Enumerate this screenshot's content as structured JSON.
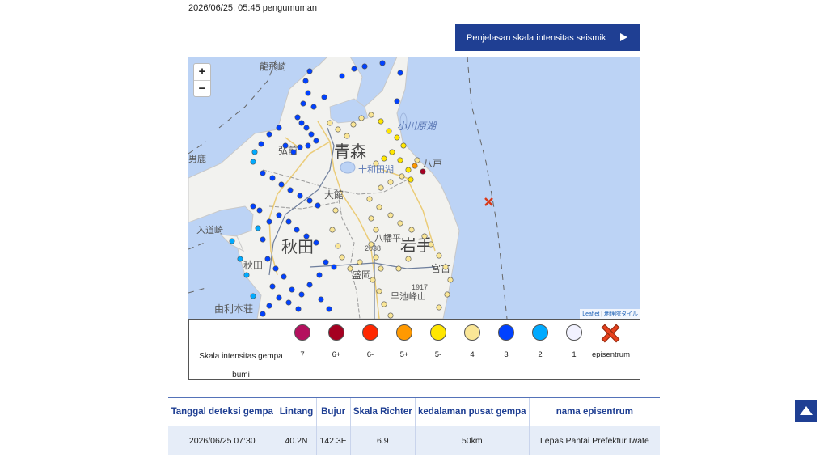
{
  "header": {
    "announcement": "2026/06/25, 05:45 pengumuman",
    "scale_button_label": "Penjelasan skala intensitas seismik"
  },
  "map": {
    "zoom_in": "+",
    "zoom_out": "−",
    "attribution_leaflet": "Leaflet",
    "attribution_sep": " | ",
    "attribution_tiles": "地理院タイル",
    "place_labels": [
      "龍飛崎",
      "青森",
      "弘前",
      "小川原湖",
      "十和田湖",
      "八戸",
      "大館",
      "秋田",
      "岩手",
      "男鹿",
      "入道崎",
      "八幡平",
      "2038",
      "盛岡",
      "宮古",
      "1917",
      "早池峰山",
      "由利本荘",
      "秋田"
    ]
  },
  "legend": {
    "title": "Skala intensitas gempa bumi",
    "items": [
      {
        "label": "7",
        "color": "#b4105e"
      },
      {
        "label": "6+",
        "color": "#a50021"
      },
      {
        "label": "6-",
        "color": "#ff2800"
      },
      {
        "label": "5+",
        "color": "#ff9900"
      },
      {
        "label": "5-",
        "color": "#ffe600"
      },
      {
        "label": "4",
        "color": "#fae696"
      },
      {
        "label": "3",
        "color": "#0041ff"
      },
      {
        "label": "2",
        "color": "#00aaff"
      },
      {
        "label": "1",
        "color": "#f2f2ff"
      }
    ],
    "epicenter_label": "episentrum"
  },
  "table": {
    "headers": [
      "Tanggal deteksi gempa",
      "Lintang",
      "Bujur",
      "Skala Richter",
      "kedalaman pusat gempa",
      "nama episentrum"
    ],
    "row": [
      "2026/06/25 07:30",
      "40.2N",
      "142.3E",
      "6.9",
      "50km",
      "Lepas Pantai Prefektur Iwate"
    ]
  },
  "colors": {
    "accent": "#1f3f93",
    "sea": "#bcd3f5",
    "land": "#f2f2ef",
    "epicenter": "#e8401c"
  }
}
